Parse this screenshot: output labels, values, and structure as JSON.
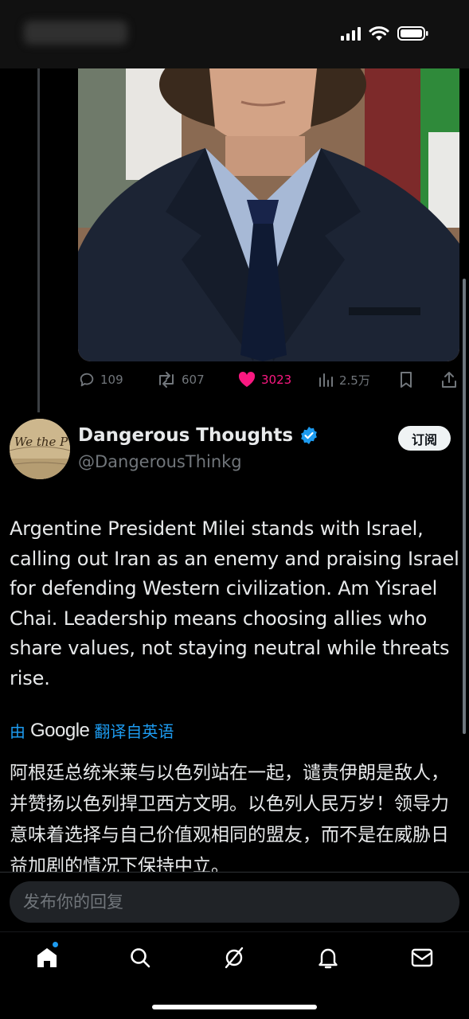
{
  "status_bar": {
    "icons": [
      "signal-icon",
      "wifi-icon",
      "battery-icon"
    ]
  },
  "media": {
    "icon": "photo-of-man-in-suit"
  },
  "actions": {
    "replies": "109",
    "reposts": "607",
    "likes": "3023",
    "views": "2.5万"
  },
  "author": {
    "name": "Dangerous Thoughts",
    "handle": "@DangerousThinkg",
    "verified": true,
    "subscribe_label": "订阅",
    "avatar_text": "We the People"
  },
  "tweet": {
    "text": "Argentine President Milei stands with Israel, calling out Iran as an enemy and praising Israel for defending Western civilization. Am Yisrael Chai. Leadership means choosing allies who share values, not staying neutral while threats rise."
  },
  "translation": {
    "by_label": "由",
    "provider": "Google",
    "from_label": "翻译自英语",
    "text": "阿根廷总统米莱与以色列站在一起，谴责伊朗是敌人，并赞扬以色列捍卫西方文明。以色列人民万岁！领导力意味着选择与自己价值观相同的盟友，而不是在威胁日益加剧的情况下保持中立。"
  },
  "reply": {
    "placeholder": "发布你的回复"
  },
  "tabs": [
    "home-icon",
    "search-icon",
    "grok-icon",
    "notifications-icon",
    "messages-icon"
  ],
  "colors": {
    "accent": "#1d9bf0",
    "like": "#f91880",
    "muted": "#71767b",
    "background": "#000000"
  }
}
